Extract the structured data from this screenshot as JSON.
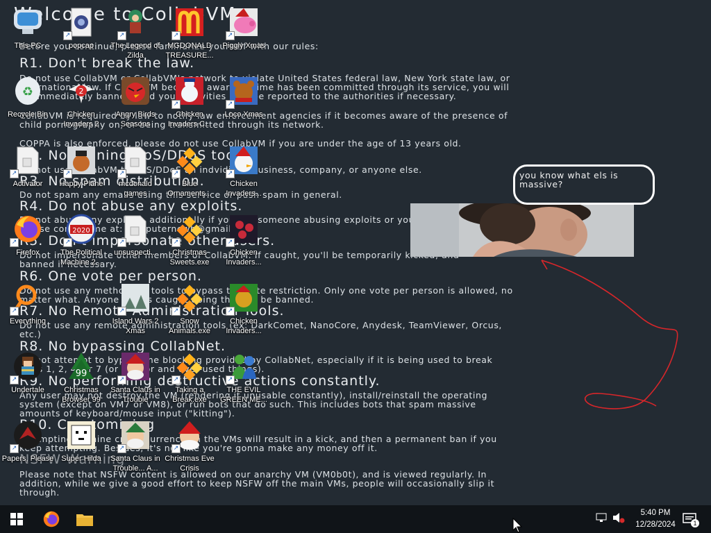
{
  "wallpaper": {
    "title": "Welcome to CollabVM",
    "intro": "Before you continue, please familiarize yourself with our rules:",
    "r1_head": "R1. Don't break the law.",
    "r1_p1": "Do not use CollabVM or CollabVM's network to violate United States federal law, New York state law, or",
    "r1_p2": "international law. If CollabVM becomes aware a crime has been committed through its service, you will",
    "r1_p3": "be immediately banned, and your activities may be reported to the authorities if necessary.",
    "r1_p4": "CollabVM is required by law to notify law enforcement agencies if it becomes aware of the presence of",
    "r1_p5": "child pornography on, or being transmitted through its network.",
    "r1_p6": "COPPA is also enforced, please do not use CollabVM if you are under the age of 13 years old.",
    "r2_head": "R2. No running DoS/DDoS tools.",
    "r2_p1": "Do not use CollabVM to DoS/DDoS an indvidiual, business, company, or anyone else.",
    "r3_head": "R3. No spam distribution.",
    "r3_p1": "Do not spam any emails using this service or push spam in general.",
    "r4_head": "R4. Do not abuse any exploits.",
    "r4_p1": "Do not abuse any exploits, additionally if you see someone abusing exploits or you need to report one,",
    "r4_p2": "please contact me at: computernewb@gmail.com",
    "r5_head": "R5. Don't impersonate other users.",
    "r5_p1": "Do not impersonate other members of CollabVM. If caught, you'll be temporarily kicked, and",
    "r5_p2": "banned if necessary.",
    "r6_head": "R6. One vote per person.",
    "r6_p1": "Do not use any methods or tools to bypass the vote restriction. Only one vote per person is allowed, no",
    "r6_p2": "matter what. Anyone who is caught doing this will be banned.",
    "r7_head": "R7. No Remote Administration Tools.",
    "r7_p1": "Do not use any remote administration tools (ex: DarkComet, NanoCore, Anydesk, TeamViewer, Orcus,",
    "r7_p2": "etc.)",
    "r8_head": "R8. No bypassing CollabNet.",
    "r8_p1": "Do not attempt to bypass the blocking provided by CollabNet, especially if it is being used to break",
    "r8_p2": "rules 1, 2, 4, or 7 (or run Tor and over-used things).",
    "r9_head": "R9. No performing destructive actions constantly.",
    "r9_p1": "Any user may not destroy the VM (rendering it unusable constantly), install/reinstall the operating",
    "r9_p2": "system (except on VM7 or VM8), or run bots that do such. This includes bots that spam massive",
    "r9_p3": "amounts of keyboard/mouse input (\"kitting\").",
    "r10_head": "R10. Cryptomining",
    "r10_p1": "Attempting to mine cryptocurrency on the VMs will result in a kick, and then a permanent ban if you",
    "r10_p2": "keep attempting. Besides, it's not like you're gonna make any money off it.",
    "nsfw_head": "NSFW Warning",
    "nsfw_p1": "Please note that NSFW content is allowed on our anarchy VM (VM0b0t), and is viewed regularly. In",
    "nsfw_p2": "addition, while we give a good effort to keep NSFW off the main VMs, people will occasionally slip it",
    "nsfw_p3": "through."
  },
  "meme": {
    "bubble_text": "you know what els is massive?"
  },
  "icons": [
    {
      "label": "This PC"
    },
    {
      "label": "popcap"
    },
    {
      "label": "The Legend of Zilda"
    },
    {
      "label": "MGDONALD TREASURE..."
    },
    {
      "label": "Piggly Xmas"
    },
    {
      "label": "Recycle Bin"
    },
    {
      "label": "Chicken Invaders 2"
    },
    {
      "label": "Angry Birds Seasons"
    },
    {
      "label": "Chicken Invaders C..."
    },
    {
      "label": "Loco Xmas"
    },
    {
      "label": "Activator"
    },
    {
      "label": "Happy Plane"
    },
    {
      "label": "mcdonald games"
    },
    {
      "label": "Blue Ornaments..."
    },
    {
      "label": "Chicken Invaders..."
    },
    {
      "label": "Firefox"
    },
    {
      "label": "The Political Machine 2..."
    },
    {
      "label": "unsuspecti..."
    },
    {
      "label": "Christmas Sweets.exe"
    },
    {
      "label": "Chicken Invaders..."
    },
    {
      "label": "Everything"
    },
    {
      "label": "Island Wars 2 Xmas"
    },
    {
      "label": "Snow Animals.exe"
    },
    {
      "label": "Chicken Invaders..."
    },
    {
      "label": "Undertale"
    },
    {
      "label": "Christmas Browser 99"
    },
    {
      "label": "Santa Claus in Trouble"
    },
    {
      "label": "Taking a Break.exe"
    },
    {
      "label": "THE EVIL GREEN ME..."
    },
    {
      "label": "Papers, Please"
    },
    {
      "label": "Super Hilda"
    },
    {
      "label": "Santa Claus in Trouble... A..."
    },
    {
      "label": "Christmas Eve Crisis"
    }
  ],
  "taskbar": {
    "time": "5:40 PM",
    "date": "12/28/2024",
    "notification_count": "1"
  },
  "colors": {
    "wallpaper": "#232b33",
    "taskbar": "#101418",
    "scribble": "#d8262a"
  }
}
